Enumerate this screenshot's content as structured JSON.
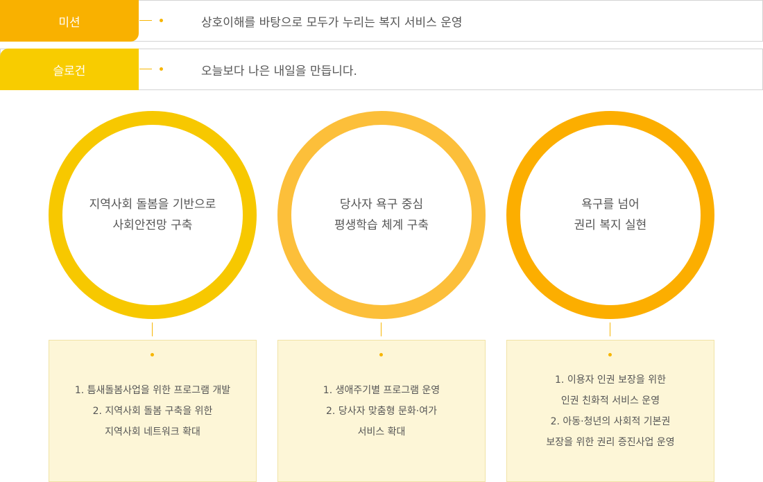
{
  "rows": [
    {
      "tag": "미션",
      "text": "상호이해를 바탕으로 모두가 누리는 복지 서비스 운영"
    },
    {
      "tag": "슬로건",
      "text": "오늘보다 나은 내일을 만듭니다."
    }
  ],
  "pillars": [
    {
      "circle": [
        "지역사회 돌봄을 기반으로",
        "사회안전망 구축"
      ],
      "details": [
        "1. 틈새돌봄사업을 위한 프로그램 개발",
        "2. 지역사회 돌봄 구축을 위한",
        "지역사회 네트워크 확대"
      ],
      "color": "#f7c800"
    },
    {
      "circle": [
        "당사자 욕구 중심",
        "평생학습 체계 구축"
      ],
      "details": [
        "1. 생애주기별 프로그램 운영",
        "2. 당사자 맞춤형 문화·여가",
        "서비스 확대"
      ],
      "color": "#fcbf3a"
    },
    {
      "circle": [
        "욕구를 넘어",
        "권리 복지 실현"
      ],
      "details": [
        "1. 이용자 인권 보장을 위한",
        "인권 친화적 서비스 운영",
        "2. 아동·청년의 사회적 기본권",
        "보장을 위한 권리 증진사업 운영"
      ],
      "color": "#fcae00"
    }
  ],
  "colors": {
    "mission_tag": "#f9b100",
    "slogan_tag": "#f8cc00",
    "accent": "#f7b500",
    "box_bg": "#fdf6d7"
  }
}
